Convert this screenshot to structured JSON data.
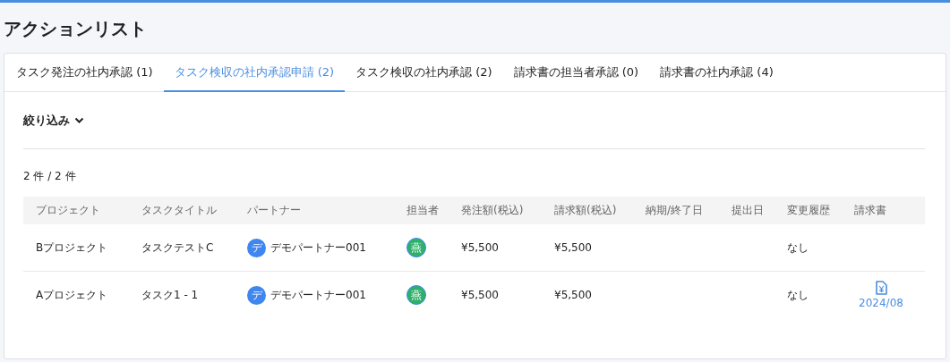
{
  "page": {
    "title": "アクションリスト"
  },
  "tabs": [
    {
      "label": "タスク発注の社内承認 (1)",
      "selected": false
    },
    {
      "label": "タスク検収の社内承認申請 (2)",
      "selected": true
    },
    {
      "label": "タスク検収の社内承認 (2)",
      "selected": false
    },
    {
      "label": "請求書の担当者承認 (0)",
      "selected": false
    },
    {
      "label": "請求書の社内承認 (4)",
      "selected": false
    }
  ],
  "filter": {
    "label": "絞り込み"
  },
  "result_count": "2 件 / 2 件",
  "table": {
    "columns": [
      "プロジェクト",
      "タスクタイトル",
      "パートナー",
      "担当者",
      "発注額(税込)",
      "請求額(税込)",
      "納期/終了日",
      "提出日",
      "変更履歴",
      "請求書"
    ],
    "rows": [
      {
        "project": "Bプロジェクト",
        "task_title": "タスクテストC",
        "partner": {
          "avatar": "デ",
          "name": "デモパートナー001"
        },
        "assignee": {
          "avatar": "燕"
        },
        "order_amount": "¥5,500",
        "invoice_amount": "¥5,500",
        "change_history": "なし"
      },
      {
        "project": "Aプロジェクト",
        "task_title": "タスク1 - 1",
        "partner": {
          "avatar": "デ",
          "name": "デモパートナー001"
        },
        "assignee": {
          "avatar": "燕"
        },
        "order_amount": "¥5,500",
        "invoice_amount": "¥5,500",
        "change_history": "なし",
        "invoice": {
          "label": "2024/08"
        }
      }
    ]
  }
}
